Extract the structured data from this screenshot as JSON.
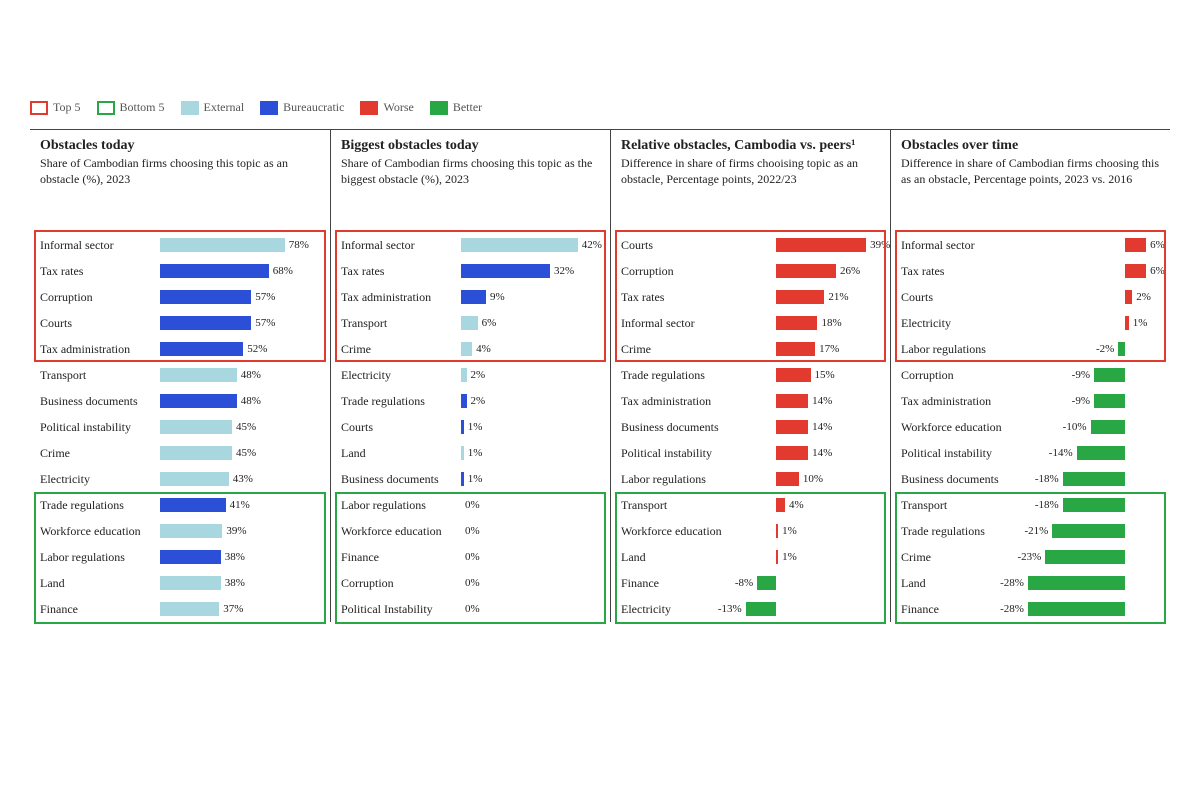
{
  "legend": {
    "top5": "Top 5",
    "bottom5": "Bottom 5",
    "external": "External",
    "bureaucratic": "Bureaucratic",
    "worse": "Worse",
    "better": "Better"
  },
  "panel_headers": [
    {
      "title": "Obstacles today",
      "sub": "Share of Cambodian firms choosing this topic as an obstacle (%), 2023"
    },
    {
      "title": "Biggest obstacles today",
      "sub": "Share of Cambodian firms choosing this topic as the biggest obstacle (%), 2023"
    },
    {
      "title": "Relative obstacles, Cambodia vs. peers¹",
      "sub": "Difference in share of firms chooising topic as an obstacle, Percentage points, 2022/23"
    },
    {
      "title": "Obstacles over time",
      "sub": "Difference in share of Cambodian firms choosing this as an obstacle, Percentage points, 2023 vs. 2016"
    }
  ],
  "chart_data": [
    {
      "type": "bar",
      "id": "panel1",
      "title": "Obstacles today",
      "subtitle": "Share of Cambodian firms choosing this topic as an obstacle (%), 2023",
      "xlabel": "",
      "ylabel": "",
      "xlim": [
        0,
        100
      ],
      "color_encoding": "External vs Bureaucratic",
      "series": [
        {
          "label": "Informal sector",
          "value": 78,
          "cat": "ext"
        },
        {
          "label": "Tax rates",
          "value": 68,
          "cat": "bur"
        },
        {
          "label": "Corruption",
          "value": 57,
          "cat": "bur"
        },
        {
          "label": "Courts",
          "value": 57,
          "cat": "bur"
        },
        {
          "label": "Tax administration",
          "value": 52,
          "cat": "bur"
        },
        {
          "label": "Transport",
          "value": 48,
          "cat": "ext"
        },
        {
          "label": "Business documents",
          "value": 48,
          "cat": "bur"
        },
        {
          "label": "Political instability",
          "value": 45,
          "cat": "ext"
        },
        {
          "label": "Crime",
          "value": 45,
          "cat": "ext"
        },
        {
          "label": "Electricity",
          "value": 43,
          "cat": "ext"
        },
        {
          "label": "Trade regulations",
          "value": 41,
          "cat": "bur"
        },
        {
          "label": "Workforce education",
          "value": 39,
          "cat": "ext"
        },
        {
          "label": "Labor regulations",
          "value": 38,
          "cat": "bur"
        },
        {
          "label": "Land",
          "value": 38,
          "cat": "ext"
        },
        {
          "label": "Finance",
          "value": 37,
          "cat": "ext"
        }
      ]
    },
    {
      "type": "bar",
      "id": "panel2",
      "title": "Biggest obstacles today",
      "subtitle": "Share of Cambodian firms choosing this topic as the biggest obstacle (%), 2023",
      "xlabel": "",
      "ylabel": "",
      "xlim": [
        0,
        50
      ],
      "color_encoding": "External vs Bureaucratic",
      "series": [
        {
          "label": "Informal sector",
          "value": 42,
          "cat": "ext"
        },
        {
          "label": "Tax rates",
          "value": 32,
          "cat": "bur"
        },
        {
          "label": "Tax administration",
          "value": 9,
          "cat": "bur"
        },
        {
          "label": "Transport",
          "value": 6,
          "cat": "ext"
        },
        {
          "label": "Crime",
          "value": 4,
          "cat": "ext"
        },
        {
          "label": "Electricity",
          "value": 2,
          "cat": "ext"
        },
        {
          "label": "Trade regulations",
          "value": 2,
          "cat": "bur"
        },
        {
          "label": "Courts",
          "value": 1,
          "cat": "bur"
        },
        {
          "label": "Land",
          "value": 1,
          "cat": "ext"
        },
        {
          "label": "Business documents",
          "value": 1,
          "cat": "bur"
        },
        {
          "label": "Labor regulations",
          "value": 0,
          "cat": "bur"
        },
        {
          "label": "Workforce education",
          "value": 0,
          "cat": "ext"
        },
        {
          "label": "Finance",
          "value": 0,
          "cat": "ext"
        },
        {
          "label": "Corruption",
          "value": 0,
          "cat": "bur"
        },
        {
          "label": "Political Instability",
          "value": 0,
          "cat": "ext"
        }
      ]
    },
    {
      "type": "bar",
      "id": "panel3",
      "title": "Relative obstacles, Cambodia vs. peers¹",
      "subtitle": "Difference in share of firms choosing topic as an obstacle, Percentage points, 2022/23",
      "xlabel": "",
      "ylabel": "",
      "xlim": [
        -15,
        45
      ],
      "color_encoding": "Worse (positive) / Better (negative)",
      "series": [
        {
          "label": "Courts",
          "value": 39
        },
        {
          "label": "Corruption",
          "value": 26
        },
        {
          "label": "Tax rates",
          "value": 21
        },
        {
          "label": "Informal sector",
          "value": 18
        },
        {
          "label": "Crime",
          "value": 17
        },
        {
          "label": "Trade regulations",
          "value": 15
        },
        {
          "label": "Tax administration",
          "value": 14
        },
        {
          "label": "Business documents",
          "value": 14
        },
        {
          "label": "Political instability",
          "value": 14
        },
        {
          "label": "Labor regulations",
          "value": 10
        },
        {
          "label": "Transport",
          "value": 4
        },
        {
          "label": "Workforce education",
          "value": 1
        },
        {
          "label": "Land",
          "value": 1
        },
        {
          "label": "Finance",
          "value": -8
        },
        {
          "label": "Electricity",
          "value": -13
        }
      ]
    },
    {
      "type": "bar",
      "id": "panel4",
      "title": "Obstacles over time",
      "subtitle": "Difference in share of Cambodian firms choosing this as an obstacle, Percentage points, 2023 vs. 2016",
      "xlabel": "",
      "ylabel": "",
      "xlim": [
        -30,
        10
      ],
      "color_encoding": "Worse (positive) / Better (negative)",
      "series": [
        {
          "label": "Informal sector",
          "value": 6
        },
        {
          "label": "Tax rates",
          "value": 6
        },
        {
          "label": "Courts",
          "value": 2
        },
        {
          "label": "Electricity",
          "value": 1
        },
        {
          "label": "Labor regulations",
          "value": -2
        },
        {
          "label": "Corruption",
          "value": -9
        },
        {
          "label": "Tax administration",
          "value": -9
        },
        {
          "label": "Workforce education",
          "value": -10
        },
        {
          "label": "Political instability",
          "value": -14
        },
        {
          "label": "Business documents",
          "value": -18
        },
        {
          "label": "Transport",
          "value": -18
        },
        {
          "label": "Trade regulations",
          "value": -21
        },
        {
          "label": "Crime",
          "value": -23
        },
        {
          "label": "Land",
          "value": -28
        },
        {
          "label": "Finance",
          "value": -28
        }
      ]
    }
  ]
}
